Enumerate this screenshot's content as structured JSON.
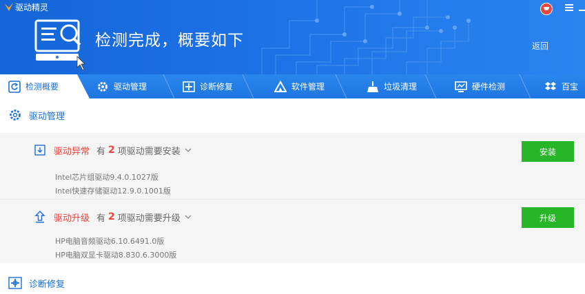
{
  "window": {
    "app_name": "驱动精灵"
  },
  "header": {
    "headline": "检测完成，概要如下",
    "back_label": "返回"
  },
  "tabs": [
    {
      "label": "检测概要",
      "icon": "refresh-icon",
      "active": true
    },
    {
      "label": "驱动管理",
      "icon": "gear-icon"
    },
    {
      "label": "诊断修复",
      "icon": "repair-icon"
    },
    {
      "label": "软件管理",
      "icon": "software-icon"
    },
    {
      "label": "垃圾清理",
      "icon": "broom-icon"
    },
    {
      "label": "硬件检测",
      "icon": "monitor-icon"
    },
    {
      "label": "百宝",
      "icon": "dropbox-icon"
    }
  ],
  "sections": {
    "driver_management": {
      "title": "驱动管理",
      "icon": "gear-icon"
    },
    "diagnose_repair": {
      "title": "诊断修复",
      "icon": "repair-icon"
    }
  },
  "abnormal": {
    "title": "驱动异常",
    "prefix": "有",
    "count": "2",
    "suffix": "项驱动需要安装",
    "button": "安装",
    "items": [
      "Intel芯片组驱动9.4.0.1027版",
      "Intel快速存储驱动12.9.0.1001版"
    ]
  },
  "upgrade": {
    "title": "驱动升级",
    "prefix": "有",
    "count": "2",
    "suffix": "项驱动需要升级",
    "button": "升级",
    "items": [
      "HP电脑音频驱动6.10.6491.0版",
      "HP电脑双显卡驱动8.830.6.3000版"
    ]
  },
  "colors": {
    "accent": "#1a6fd6",
    "warning": "#e8453c",
    "action": "#27b628"
  }
}
